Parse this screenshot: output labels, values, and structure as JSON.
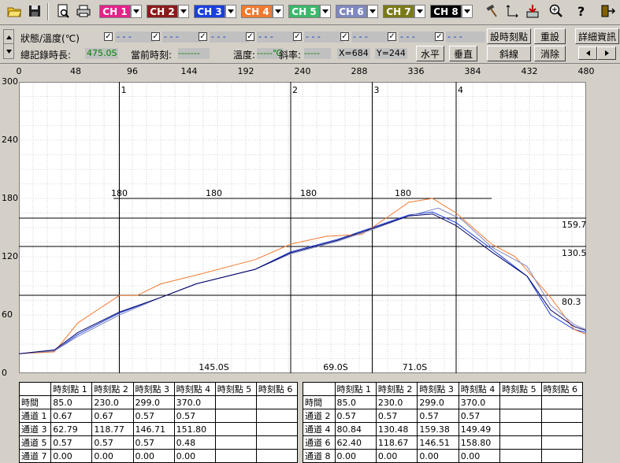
{
  "toolbar": {
    "icons": [
      "open-folder-icon",
      "save-disk-icon",
      "print-preview-icon",
      "print-icon"
    ],
    "channels": [
      {
        "label": "CH 1",
        "color": "#e8208a"
      },
      {
        "label": "CH 2",
        "color": "#8b1a1a"
      },
      {
        "label": "CH 3",
        "color": "#1a3fe0"
      },
      {
        "label": "CH 4",
        "color": "#f07a30"
      },
      {
        "label": "CH 5",
        "color": "#3cb86a"
      },
      {
        "label": "CH 6",
        "color": "#8088c0"
      },
      {
        "label": "CH 7",
        "color": "#7a7a18"
      },
      {
        "label": "CH 8",
        "color": "#000000"
      }
    ],
    "tool_icons": [
      "hammer-icon",
      "axes-icon",
      "download-icon",
      "zoom-icon",
      "help-icon",
      "exit-icon"
    ]
  },
  "status": {
    "state_label": "狀態/溫度(℃)",
    "checkbox_values": [
      "- - -",
      "- - -",
      "- - -",
      "- - -",
      "- - -",
      "- - -",
      "- - -",
      "- - -"
    ],
    "total_label": "總記錄時長:",
    "total_value": "475.0S",
    "current_label": "當前時刻:",
    "current_value": "-------",
    "temp_label": "溫度:",
    "temp_value": "-----℃",
    "slope_label": "斜率:",
    "slope_value": "-----",
    "x_label": "X=684",
    "y_label": "Y=244"
  },
  "buttons": {
    "set_time": "設時刻點",
    "reset": "重設",
    "details": "詳細資訊",
    "horizontal": "水平",
    "vertical": "垂直",
    "diagonal": "斜線",
    "clear": "消除"
  },
  "chart_data": {
    "type": "line",
    "xlim": [
      0,
      480
    ],
    "ylim": [
      0,
      300
    ],
    "x_ticks": [
      "0",
      "48",
      "96",
      "144",
      "192",
      "240",
      "288",
      "336",
      "384",
      "432",
      "480"
    ],
    "y_ticks": [
      "300",
      "240",
      "180",
      "120",
      "60",
      "0"
    ],
    "grid": true,
    "vlines": [
      {
        "label": "1",
        "x": 85
      },
      {
        "label": "2",
        "x": 230
      },
      {
        "label": "3",
        "x": 299
      },
      {
        "label": "4",
        "x": 370
      }
    ],
    "hlines": [
      {
        "label": "159.7",
        "y": 159.7
      },
      {
        "label": "130.5",
        "y": 130.5
      },
      {
        "label": "80.3",
        "y": 80.3
      }
    ],
    "ref_line": {
      "y": 180,
      "x1": 80,
      "x2": 400,
      "labels": [
        {
          "x": 85,
          "text": "180"
        },
        {
          "x": 165,
          "text": "180"
        },
        {
          "x": 245,
          "text": "180"
        },
        {
          "x": 325,
          "text": "180"
        }
      ]
    },
    "interval_labels": [
      {
        "x": 165,
        "text": "145.0S"
      },
      {
        "x": 268,
        "text": "69.0S"
      },
      {
        "x": 335,
        "text": "71.0S"
      }
    ],
    "series": [
      {
        "color": "#1a3fe0",
        "points": [
          [
            0,
            20
          ],
          [
            30,
            23
          ],
          [
            50,
            40
          ],
          [
            85,
            62
          ],
          [
            120,
            78
          ],
          [
            150,
            92
          ],
          [
            200,
            107
          ],
          [
            230,
            125
          ],
          [
            270,
            138
          ],
          [
            299,
            150
          ],
          [
            330,
            163
          ],
          [
            350,
            166
          ],
          [
            370,
            155
          ],
          [
            400,
            128
          ],
          [
            430,
            100
          ],
          [
            450,
            60
          ],
          [
            470,
            45
          ],
          [
            480,
            42
          ]
        ]
      },
      {
        "color": "#f07a30",
        "points": [
          [
            0,
            20
          ],
          [
            30,
            22
          ],
          [
            50,
            52
          ],
          [
            85,
            80
          ],
          [
            100,
            80
          ],
          [
            120,
            92
          ],
          [
            150,
            101
          ],
          [
            200,
            117
          ],
          [
            230,
            133
          ],
          [
            260,
            141
          ],
          [
            290,
            143
          ],
          [
            299,
            150
          ],
          [
            330,
            176
          ],
          [
            350,
            180
          ],
          [
            370,
            165
          ],
          [
            400,
            133
          ],
          [
            420,
            120
          ],
          [
            450,
            78
          ],
          [
            470,
            45
          ],
          [
            480,
            40
          ]
        ]
      },
      {
        "color": "#8088c0",
        "points": [
          [
            0,
            20
          ],
          [
            30,
            23
          ],
          [
            50,
            38
          ],
          [
            85,
            60
          ],
          [
            120,
            78
          ],
          [
            150,
            92
          ],
          [
            200,
            107
          ],
          [
            230,
            123
          ],
          [
            270,
            136
          ],
          [
            299,
            148
          ],
          [
            330,
            162
          ],
          [
            355,
            170
          ],
          [
            375,
            158
          ],
          [
            400,
            130
          ],
          [
            430,
            110
          ],
          [
            450,
            70
          ],
          [
            470,
            50
          ],
          [
            480,
            45
          ]
        ]
      },
      {
        "color": "#000060",
        "points": [
          [
            0,
            20
          ],
          [
            30,
            24
          ],
          [
            50,
            42
          ],
          [
            85,
            63
          ],
          [
            120,
            78
          ],
          [
            150,
            92
          ],
          [
            200,
            107
          ],
          [
            230,
            124
          ],
          [
            270,
            137
          ],
          [
            299,
            149
          ],
          [
            330,
            162
          ],
          [
            350,
            164
          ],
          [
            370,
            152
          ],
          [
            400,
            125
          ],
          [
            430,
            100
          ],
          [
            450,
            65
          ],
          [
            470,
            48
          ],
          [
            480,
            44
          ]
        ]
      }
    ]
  },
  "tables": {
    "left": {
      "headers": [
        "",
        "時刻點 1",
        "時刻點 2",
        "時刻點 3",
        "時刻點 4",
        "時刻點 5",
        "時刻點 6"
      ],
      "rows": [
        [
          "時間",
          "85.0",
          "230.0",
          "299.0",
          "370.0",
          "",
          ""
        ],
        [
          "通道 1",
          "0.67",
          "0.67",
          "0.57",
          "0.57",
          "",
          ""
        ],
        [
          "通道 3",
          "62.79",
          "118.77",
          "146.71",
          "151.80",
          "",
          ""
        ],
        [
          "通道 5",
          "0.57",
          "0.57",
          "0.57",
          "0.48",
          "",
          ""
        ],
        [
          "通道 7",
          "0.00",
          "0.00",
          "0.00",
          "0.00",
          "",
          ""
        ]
      ]
    },
    "right": {
      "headers": [
        "",
        "時刻點 1",
        "時刻點 2",
        "時刻點 3",
        "時刻點 4",
        "時刻點 5",
        "時刻點 6"
      ],
      "rows": [
        [
          "時間",
          "85.0",
          "230.0",
          "299.0",
          "370.0",
          "",
          ""
        ],
        [
          "通道 2",
          "0.57",
          "0.57",
          "0.57",
          "0.57",
          "",
          ""
        ],
        [
          "通道 4",
          "80.84",
          "130.48",
          "159.38",
          "149.49",
          "",
          ""
        ],
        [
          "通道 6",
          "62.40",
          "118.67",
          "146.51",
          "158.80",
          "",
          ""
        ],
        [
          "通道 8",
          "0.00",
          "0.00",
          "0.00",
          "0.00",
          "",
          ""
        ]
      ]
    }
  }
}
